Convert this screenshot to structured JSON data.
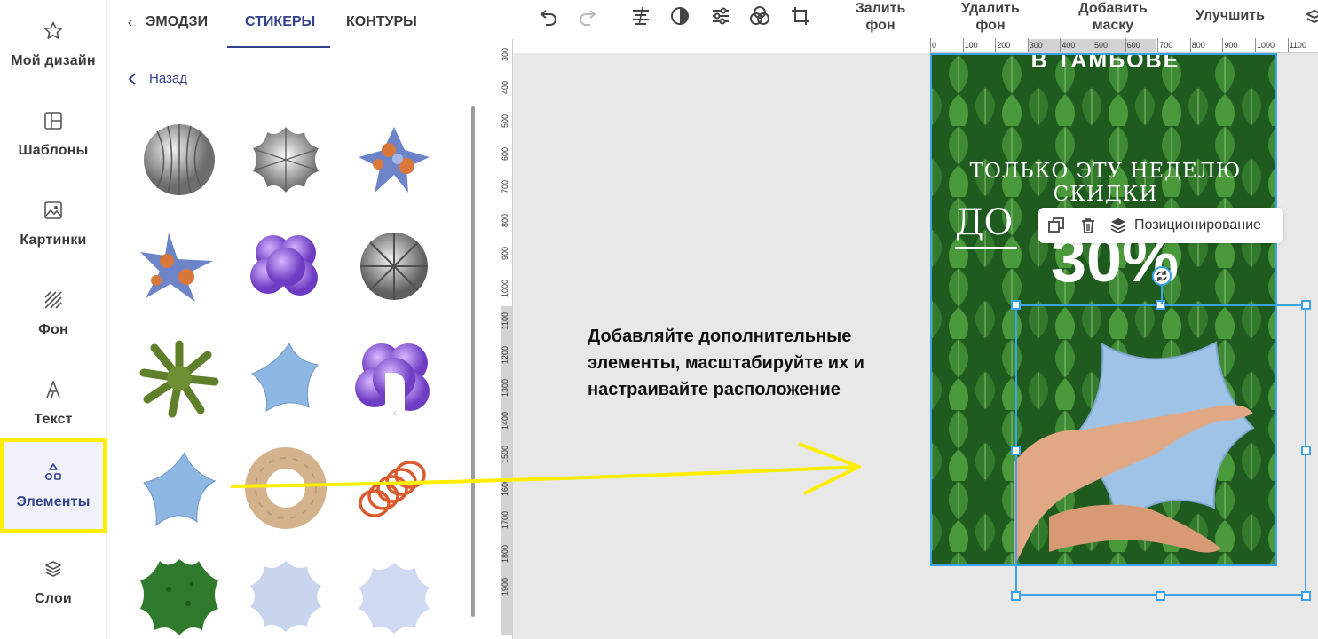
{
  "rail": {
    "items": [
      {
        "label": "Мой дизайн",
        "icon": "star-icon"
      },
      {
        "label": "Шаблоны",
        "icon": "templates-icon"
      },
      {
        "label": "Картинки",
        "icon": "image-icon"
      },
      {
        "label": "Фон",
        "icon": "background-icon"
      },
      {
        "label": "Текст",
        "icon": "text-icon"
      },
      {
        "label": "Элементы",
        "icon": "elements-icon",
        "active": true
      },
      {
        "label": "Слои",
        "icon": "layers-icon"
      }
    ]
  },
  "panel": {
    "tabs": [
      {
        "label": "ЭМОДЗИ"
      },
      {
        "label": "СТИКЕРЫ",
        "active": true
      },
      {
        "label": "КОНТУРЫ"
      }
    ],
    "back_label": "Назад",
    "stickers": [
      "silver-ridged-ball",
      "silver-flower",
      "fluffy-blue-orange-star",
      "fluffy-blue-orange-star",
      "purple-blob",
      "silver-ridged-ball",
      "green-spiky-ball",
      "blue-star",
      "purple-blob",
      "blue-star",
      "beige-ring",
      "orange-spring",
      "green-sponge-flower",
      "pale-blue-flower",
      "pale-blue-flower"
    ]
  },
  "toolbar": {
    "fill_bg": "Залить\nфон",
    "remove_bg": "Удалить\nфон",
    "add_mask": "Добавить\nмаску",
    "improve": "Улучшить"
  },
  "ruler_top": [
    "0",
    "100",
    "200",
    "300",
    "400",
    "500",
    "600",
    "700",
    "800",
    "900",
    "1000",
    "1100"
  ],
  "ruler_left": [
    "300",
    "400",
    "500",
    "600",
    "700",
    "800",
    "900",
    "1000",
    "1100",
    "1200",
    "1300",
    "1400",
    "1500",
    "1600",
    "1700",
    "1800",
    "1900"
  ],
  "canvas": {
    "instruction": "Добавляйте дополнительные элементы, масштабируйте их и настраивайте расположение",
    "design": {
      "city": "В ТАМБОВЕ",
      "promo": "ТОЛЬКО ЭТУ НЕДЕЛЮ СКИДКИ",
      "do": "ДО",
      "percent": "30%"
    },
    "context_menu": {
      "position_label": "Позиционирование"
    }
  },
  "colors": {
    "accent": "#33428a",
    "selection": "#3aa3ea",
    "highlight": "#ffee00",
    "canvas_bg": "#e8e8e8"
  }
}
